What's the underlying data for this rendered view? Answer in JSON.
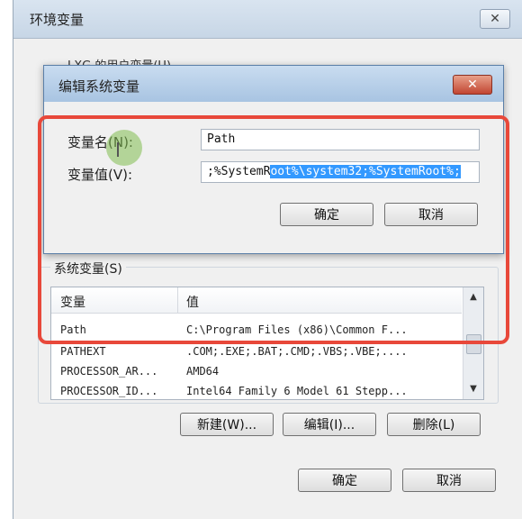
{
  "outer": {
    "title": "环境变量",
    "close_icon": "✕",
    "user_vars_label": "LXG 的用户变量(U)",
    "ok_label": "确定",
    "cancel_label": "取消"
  },
  "dialog": {
    "title": "编辑系统变量",
    "close_icon": "✕",
    "name_label": "变量名(N):",
    "value_label": "变量值(V):",
    "name_value": "Path",
    "value_value_plain": ";%SystemR",
    "value_value_selected": "oot%\\system32;%SystemRoot%;",
    "ok_label": "确定",
    "cancel_label": "取消"
  },
  "system_vars": {
    "label": "系统变量(S)",
    "columns": [
      "变量",
      "值"
    ],
    "rows": [
      {
        "name": "Path",
        "value": "C:\\Program Files (x86)\\Common F..."
      },
      {
        "name": "PATHEXT",
        "value": ".COM;.EXE;.BAT;.CMD;.VBS;.VBE;...."
      },
      {
        "name": "PROCESSOR_AR...",
        "value": "AMD64"
      },
      {
        "name": "PROCESSOR_ID...",
        "value": "Intel64 Family 6 Model 61 Stepp..."
      }
    ],
    "new_label": "新建(W)...",
    "edit_label": "编辑(I)...",
    "delete_label": "删除(L)",
    "scroll_up_icon": "▲",
    "scroll_down_icon": "▼"
  },
  "colors": {
    "highlight": "#e8483a",
    "selection": "#3399ff"
  }
}
